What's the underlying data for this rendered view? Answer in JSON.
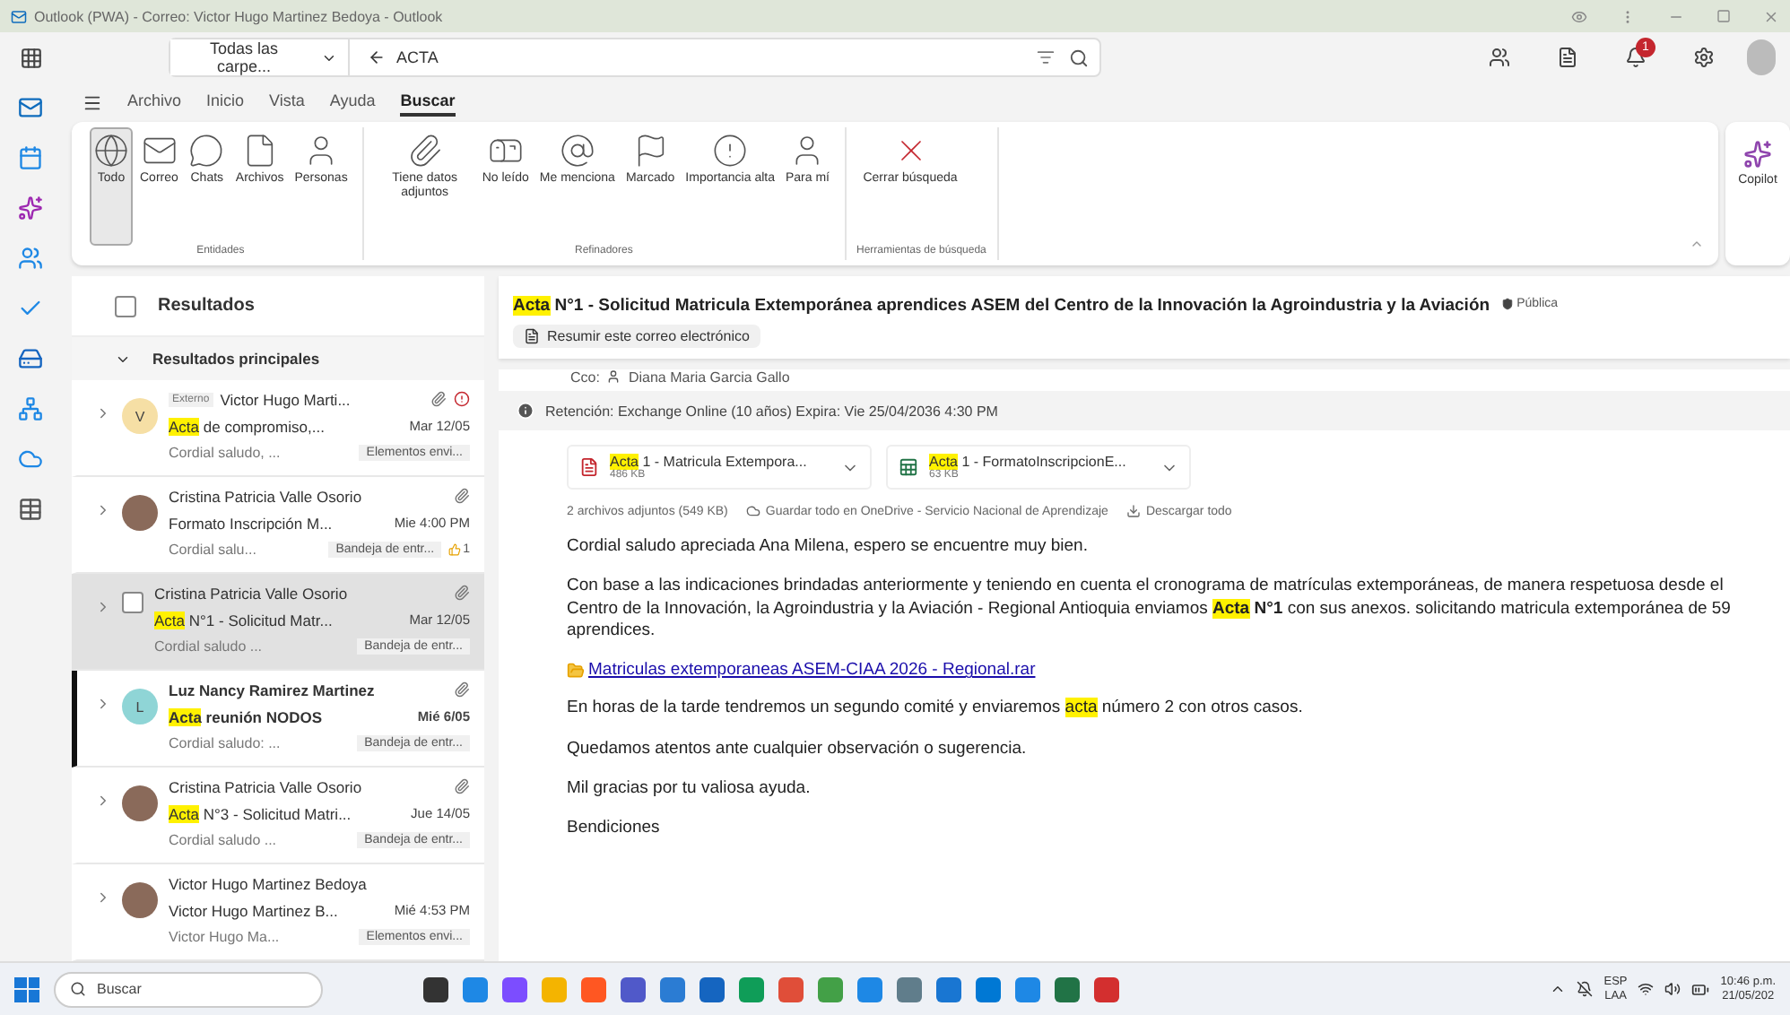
{
  "window": {
    "title": "Outlook (PWA) - Correo: Victor Hugo Martinez Bedoya - Outlook"
  },
  "search": {
    "scope": "Todas las carpe...",
    "query": "ACTA"
  },
  "notifications": {
    "count": "1"
  },
  "menu_tabs": [
    {
      "label": "Archivo",
      "selected": false
    },
    {
      "label": "Inicio",
      "selected": false
    },
    {
      "label": "Vista",
      "selected": false
    },
    {
      "label": "Ayuda",
      "selected": false
    },
    {
      "label": "Buscar",
      "selected": true
    }
  ],
  "ribbon": {
    "groups": [
      {
        "label": "Entidades",
        "items": [
          {
            "label": "Todo",
            "selected": true
          },
          {
            "label": "Correo",
            "selected": false
          },
          {
            "label": "Chats",
            "selected": false
          },
          {
            "label": "Archivos",
            "selected": false
          },
          {
            "label": "Personas",
            "selected": false
          }
        ]
      },
      {
        "label": "Refinadores",
        "items": [
          {
            "label": "Tiene datos adjuntos",
            "selected": false
          },
          {
            "label": "No leído",
            "selected": false
          },
          {
            "label": "Me menciona",
            "selected": false
          },
          {
            "label": "Marcado",
            "selected": false
          },
          {
            "label": "Importancia alta",
            "selected": false
          },
          {
            "label": "Para mí",
            "selected": false
          }
        ]
      },
      {
        "label": "Herramientas de búsqueda",
        "items": [
          {
            "label": "Cerrar búsqueda",
            "selected": false
          }
        ]
      }
    ],
    "copilot": "Copilot"
  },
  "list": {
    "title": "Resultados",
    "all_checked": false,
    "group": "Resultados principales",
    "group_expanded": true,
    "messages": [
      {
        "kind": "initial",
        "initial": "V",
        "color": "#f6dfa5",
        "tag": "Externo",
        "sender": "Victor Hugo Marti...",
        "subject": [
          {
            "text": "Acta",
            "highlighted": true
          },
          {
            "text": " de compromiso,...",
            "highlighted": false
          }
        ],
        "date": "Mar 12/05",
        "preview": "Cordial saludo, ...",
        "folder": "Elementos envi...",
        "attachment": true,
        "important": true,
        "unread": false,
        "selected": false
      },
      {
        "kind": "photo",
        "sender": "Cristina Patricia Valle Osorio",
        "subject": [
          {
            "text": "Formato Inscripción M...",
            "highlighted": false
          }
        ],
        "date": "Mie 4:00 PM",
        "preview": "Cordial salu...",
        "folder": "Bandeja de entr...",
        "reaction": "1",
        "attachment": true,
        "important": false,
        "unread": false,
        "selected": false
      },
      {
        "kind": "checkbox",
        "checked": false,
        "sender": "Cristina Patricia Valle Osorio",
        "subject": [
          {
            "text": "Acta",
            "highlighted": true
          },
          {
            "text": " N°1 - Solicitud Matr...",
            "highlighted": false
          }
        ],
        "date": "Mar 12/05",
        "preview": "Cordial saludo ...",
        "folder": "Bandeja de entr...",
        "attachment": true,
        "important": false,
        "unread": false,
        "selected": true
      },
      {
        "kind": "initial",
        "initial": "L",
        "color": "#8fd5d6",
        "sender": "Luz Nancy Ramirez Martinez",
        "subject": [
          {
            "text": "Acta",
            "highlighted": true
          },
          {
            "text": " reunión NODOS",
            "highlighted": false
          }
        ],
        "date": "Mié 6/05",
        "preview": "Cordial saludo: ...",
        "folder": "Bandeja de entr...",
        "attachment": true,
        "important": false,
        "unread": true,
        "selected": false
      },
      {
        "kind": "photo",
        "sender": "Cristina Patricia Valle Osorio",
        "subject": [
          {
            "text": "Acta",
            "highlighted": true
          },
          {
            "text": " N°3 - Solicitud Matri...",
            "highlighted": false
          }
        ],
        "date": "Jue 14/05",
        "preview": "Cordial saludo ...",
        "folder": "Bandeja de entr...",
        "attachment": true,
        "important": false,
        "unread": false,
        "selected": false
      },
      {
        "kind": "photo",
        "sender": "Victor Hugo Martinez Bedoya",
        "subject": [
          {
            "text": "Victor Hugo Martinez B...",
            "highlighted": false
          }
        ],
        "date": "Mié 4:53 PM",
        "preview": "Victor Hugo Ma...",
        "folder": "Elementos envi...",
        "attachment": false,
        "important": false,
        "unread": false,
        "selected": false
      }
    ]
  },
  "reading": {
    "subject": [
      {
        "text": "Acta",
        "highlighted": true
      },
      {
        "text": " N°1 - Solicitud Matricula Extemporánea aprendices ASEM del Centro de la Innovación la Agroindustria y la Aviación",
        "highlighted": false
      }
    ],
    "sensitivity": "Pública",
    "summarize": "Resumir este correo electrónico",
    "cc_label": "Cco:",
    "cc_name": "Diana Maria Garcia Gallo",
    "retention": "Retención: Exchange Online (10 años) Expira: Vie 25/04/2036 4:30 PM",
    "attachments": [
      {
        "kind": "pdf",
        "name": [
          {
            "text": "Acta",
            "highlighted": true
          },
          {
            "text": " 1 - Matricula Extempora...",
            "highlighted": false
          }
        ],
        "size": "486 KB"
      },
      {
        "kind": "excel",
        "name": [
          {
            "text": "Acta",
            "highlighted": true
          },
          {
            "text": " 1 - FormatoInscripcionE...",
            "highlighted": false
          }
        ],
        "size": "63 KB"
      }
    ],
    "attachment_summary": "2 archivos adjuntos (549 KB)",
    "save_all": "Guardar todo en OneDrive - Servicio Nacional de Aprendizaje",
    "download_all": "Descargar todo",
    "body": [
      {
        "kind": "text",
        "segments": [
          {
            "text": "Cordial saludo apreciada Ana Milena, espero se encuentre muy bien.",
            "highlighted": false,
            "bold": false
          }
        ]
      },
      {
        "kind": "text",
        "segments": [
          {
            "text": "Con base a las indicaciones brindadas anteriormente y teniendo en cuenta el cronograma de matrículas extemporáneas, de manera respetuosa desde el Centro de la Innovación, la Agroindustria y la Aviación - Regional Antioquia enviamos ",
            "highlighted": false,
            "bold": false
          },
          {
            "text": "Acta",
            "highlighted": true,
            "bold": true
          },
          {
            "text": " N°1",
            "highlighted": false,
            "bold": true
          },
          {
            "text": " con sus anexos. solicitando matricula extemporánea de 59 aprendices.",
            "highlighted": false,
            "bold": false
          }
        ]
      },
      {
        "kind": "link",
        "text": "Matriculas extemporaneas ASEM-CIAA 2026 - Regional.rar"
      },
      {
        "kind": "text",
        "segments": [
          {
            "text": "En horas de la tarde tendremos un segundo comité y enviaremos ",
            "highlighted": false,
            "bold": false
          },
          {
            "text": "acta",
            "highlighted": true,
            "bold": false
          },
          {
            "text": " número 2 con otros casos.",
            "highlighted": false,
            "bold": false
          }
        ]
      },
      {
        "kind": "text",
        "segments": [
          {
            "text": "Quedamos atentos ante cualquier observación o sugerencia.",
            "highlighted": false,
            "bold": false
          }
        ]
      },
      {
        "kind": "text",
        "segments": [
          {
            "text": "Mil gracias por tu valiosa ayuda.",
            "highlighted": false,
            "bold": false
          }
        ]
      },
      {
        "kind": "text",
        "segments": [
          {
            "text": "Bendiciones",
            "highlighted": false,
            "bold": false
          }
        ]
      }
    ]
  },
  "taskbar": {
    "search": "Buscar",
    "language": "ESP",
    "layout": "LAA",
    "time": "10:46 p.m.",
    "date": "21/05/202"
  }
}
